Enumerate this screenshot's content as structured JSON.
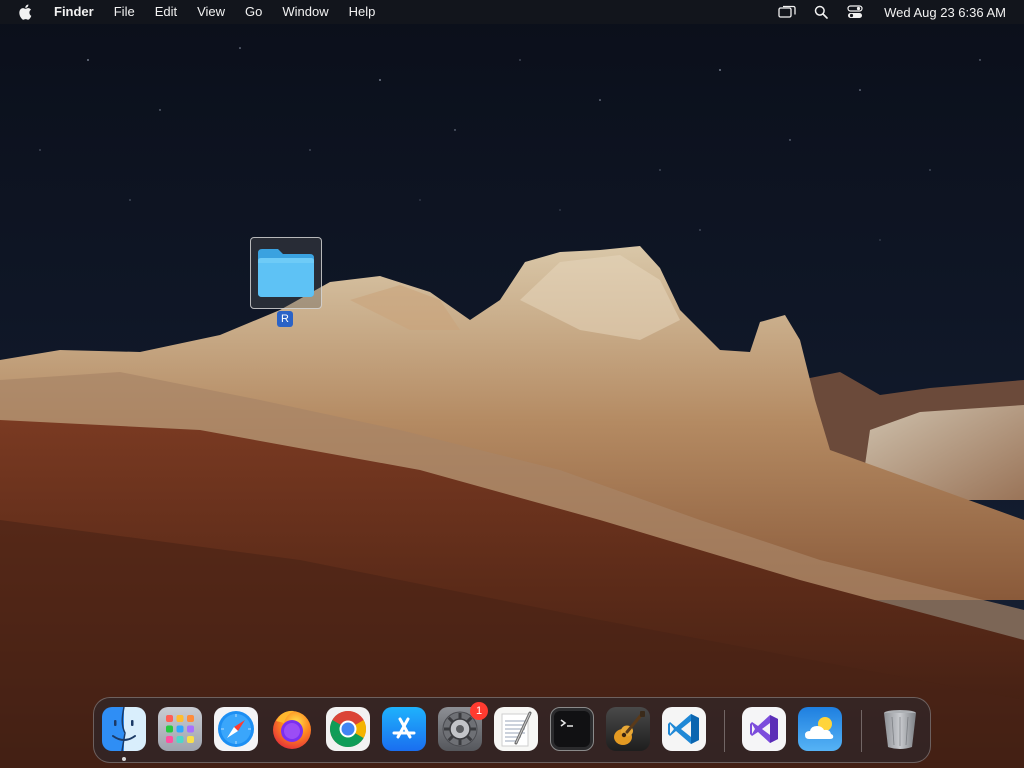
{
  "menubar": {
    "app_name": "Finder",
    "items": [
      "File",
      "Edit",
      "View",
      "Go",
      "Window",
      "Help"
    ],
    "clock": "Wed Aug 23  6:36 AM",
    "status_icons": [
      "screen-mirroring-icon",
      "spotlight-search-icon",
      "control-center-icon"
    ]
  },
  "desktop": {
    "folder": {
      "label": "R",
      "selected": true,
      "color": "#5ec2f5"
    }
  },
  "dock": {
    "apps": [
      "Finder",
      "Launchpad",
      "Safari",
      "Firefox",
      "Google Chrome",
      "App Store",
      "System Settings",
      "TextEdit",
      "Terminal",
      "GarageBand",
      "Visual Studio Code",
      "Visual Studio",
      "Weather",
      "Trash"
    ],
    "system_settings_badge": "1"
  }
}
